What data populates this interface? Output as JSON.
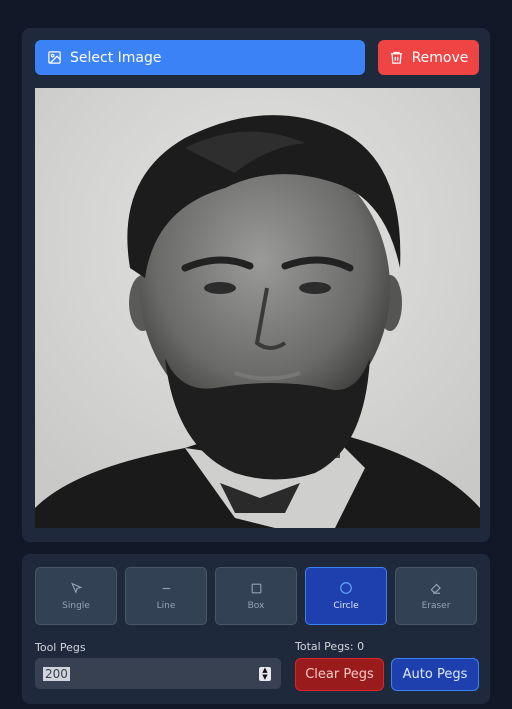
{
  "image_panel": {
    "select_button_label": "Select Image",
    "remove_button_label": "Remove",
    "select_icon": "image-icon",
    "remove_icon": "trash-icon"
  },
  "tools": [
    {
      "label": "Single",
      "icon": "cursor-arrow-icon",
      "active": false
    },
    {
      "label": "Line",
      "icon": "line-icon",
      "active": false
    },
    {
      "label": "Box",
      "icon": "square-icon",
      "active": false
    },
    {
      "label": "Circle",
      "icon": "circle-icon",
      "active": true
    },
    {
      "label": "Eraser",
      "icon": "eraser-icon",
      "active": false
    }
  ],
  "controls": {
    "tool_pegs_label": "Tool Pegs",
    "tool_pegs_value": "200",
    "total_pegs_label": "Total Pegs: 0",
    "clear_button_label": "Clear Pegs",
    "auto_button_label": "Auto Pegs"
  },
  "colors": {
    "primary": "#3b82f6",
    "danger": "#ef4444",
    "panel": "#1e293b",
    "background": "#111827"
  }
}
